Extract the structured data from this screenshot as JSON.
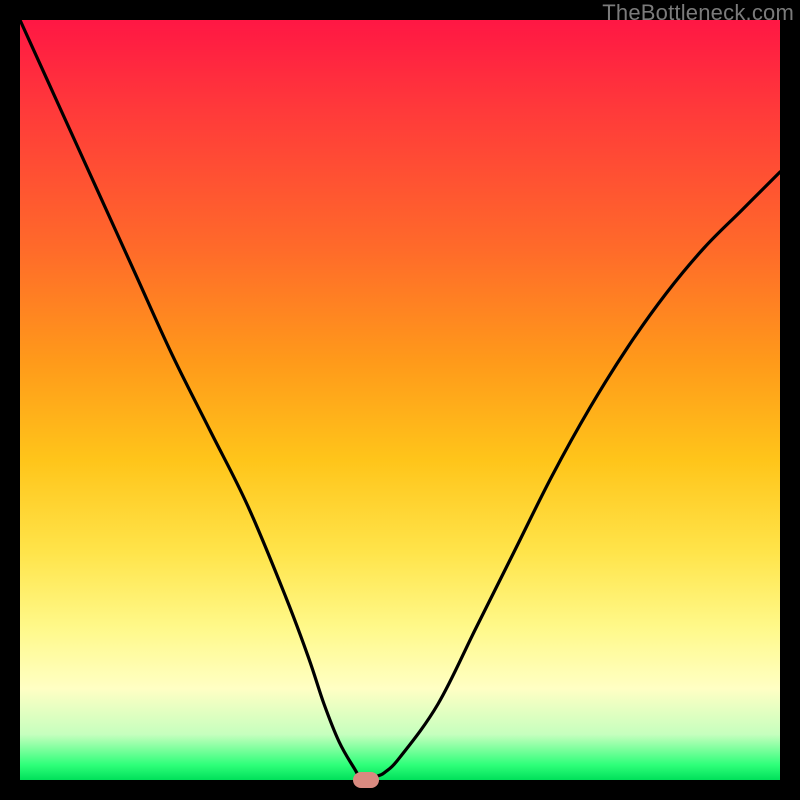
{
  "watermark": "TheBottleneck.com",
  "colors": {
    "frame": "#000000",
    "gradient_top": "#ff1744",
    "gradient_mid": "#ffe44a",
    "gradient_bottom": "#00e05a",
    "curve": "#000000",
    "marker": "#d98a80"
  },
  "chart_data": {
    "type": "line",
    "title": "",
    "xlabel": "",
    "ylabel": "",
    "x_range": [
      0,
      100
    ],
    "y_range": [
      0,
      100
    ],
    "series": [
      {
        "name": "bottleneck-curve",
        "x": [
          0,
          5,
          10,
          15,
          20,
          25,
          30,
          35,
          38,
          40,
          42,
          44,
          45,
          46,
          47,
          48,
          50,
          55,
          60,
          65,
          70,
          75,
          80,
          85,
          90,
          95,
          100
        ],
        "y": [
          100,
          89,
          78,
          67,
          56,
          46,
          36,
          24,
          16,
          10,
          5,
          1.5,
          0,
          0,
          0.5,
          1,
          3,
          10,
          20,
          30,
          40,
          49,
          57,
          64,
          70,
          75,
          80
        ]
      }
    ],
    "marker": {
      "x": 45.5,
      "y": 0
    },
    "notes": "Values estimated from pixel positions; y=0 is bottom (green), y=100 is top (red). Curve minimum near x≈45."
  }
}
